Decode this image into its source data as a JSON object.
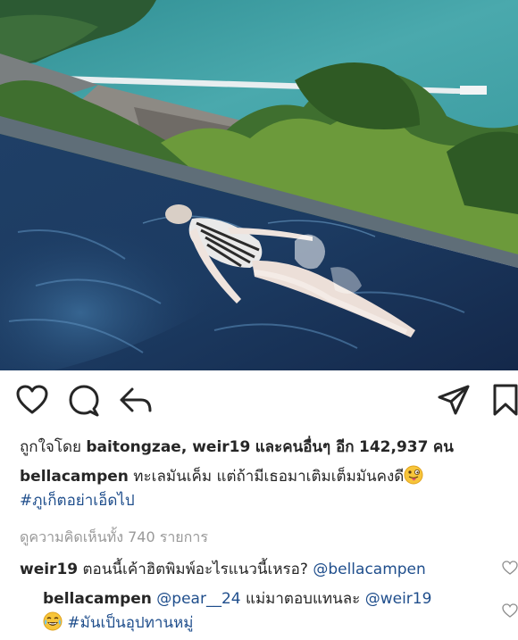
{
  "post": {
    "likes_prefix": "ถูกใจโดย",
    "likers": "baitongzae, weir19",
    "likes_middle": "และคนอื่นๆ อีก",
    "likes_count": "142,937",
    "likes_suffix": "คน",
    "caption_user": "bellacampen",
    "caption_text": "ทะเลมันเค็ม แต่ถ้ามีเธอมาเติมเต็มมันคงดี",
    "caption_hashtag": "#ภูเก็ตอย่าเอ็ดไป",
    "view_all_comments": "ดูความคิดเห็นทั้ง 740 รายการ"
  },
  "comments": [
    {
      "user": "weir19",
      "text": "ตอนนี้เค้าฮิตพิมพ์อะไรแนวนี้เหรอ?",
      "mention": "@bellacampen"
    }
  ],
  "reply": {
    "user": "bellacampen",
    "mention1": "@pear__24",
    "text": "แม่มาตอบแทนละ",
    "mention2": "@weir19",
    "hashtag": "#มันเป็นอุปทานหมู่"
  },
  "icons": [
    "heart-icon",
    "comment-icon",
    "share-icon",
    "direct-icon",
    "bookmark-icon",
    "emoji-tongue-icon",
    "emoji-laugh-icon"
  ],
  "colors": {
    "text": "#262626",
    "hashtag": "#1f4e8c",
    "muted": "#999999"
  }
}
